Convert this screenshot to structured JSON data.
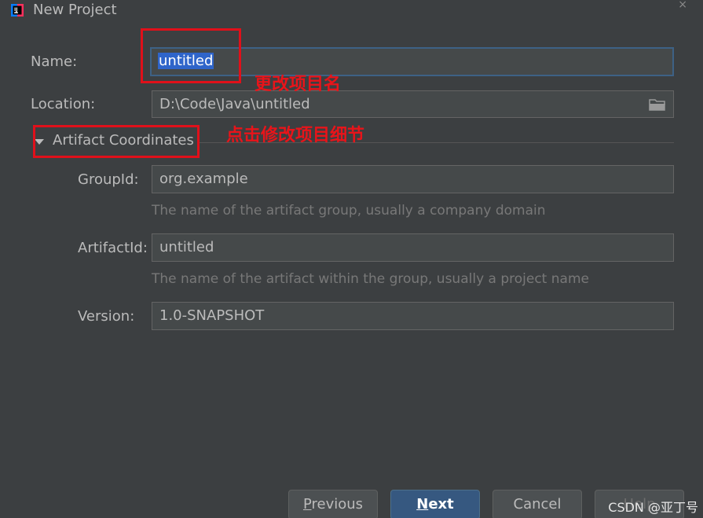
{
  "window": {
    "title": "New Project",
    "close_glyph": "×"
  },
  "fields": {
    "name": {
      "label": "Name:",
      "value": "untitled"
    },
    "location": {
      "label": "Location:",
      "value": "D:\\Code\\Java\\untitled"
    }
  },
  "artifact": {
    "section_label": "Artifact Coordinates",
    "group": {
      "label": "GroupId:",
      "value": "org.example",
      "hint": "The name of the artifact group, usually a company domain"
    },
    "artifact": {
      "label": "ArtifactId:",
      "value": "untitled",
      "hint": "The name of the artifact within the group, usually a project name"
    },
    "version": {
      "label": "Version:",
      "value": "1.0-SNAPSHOT"
    }
  },
  "annotations": {
    "rename": "更改项目名",
    "details": "点击修改项目细节"
  },
  "buttons": {
    "previous": {
      "mnemonic": "P",
      "rest": "revious"
    },
    "next": {
      "mnemonic": "N",
      "rest": "ext"
    },
    "cancel": "Cancel",
    "help": "Help"
  },
  "watermark": "CSDN @亚丁号",
  "colors": {
    "background": "#3c3f41",
    "field": "#45494a",
    "selection": "#2f65ca",
    "annotation": "#e0101a",
    "primary_button": "#365880"
  }
}
